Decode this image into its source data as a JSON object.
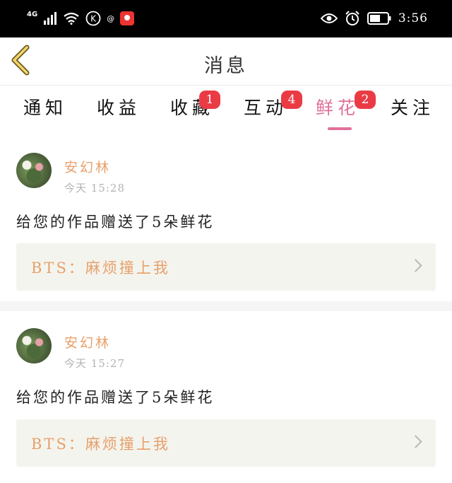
{
  "status_bar": {
    "network": "4G",
    "k_label": "K",
    "at_label": "@",
    "time": "3:56"
  },
  "header": {
    "title": "消息"
  },
  "tabs": [
    {
      "label": "通知",
      "badge": ""
    },
    {
      "label": "收益",
      "badge": ""
    },
    {
      "label": "收藏",
      "badge": "1"
    },
    {
      "label": "互动",
      "badge": "4"
    },
    {
      "label": "鲜花",
      "badge": "2",
      "active": true
    },
    {
      "label": "关注",
      "badge": ""
    }
  ],
  "notifications": [
    {
      "user": "安幻林",
      "time": "今天 15:28",
      "message": "给您的作品赠送了5朵鲜花",
      "work": "BTS：麻烦撞上我"
    },
    {
      "user": "安幻林",
      "time": "今天 15:27",
      "message": "给您的作品赠送了5朵鲜花",
      "work": "BTS：麻烦撞上我"
    }
  ],
  "colors": {
    "accent_pink": "#e0709a",
    "username_orange": "#e7a06a",
    "badge_red": "#ea3b45"
  }
}
